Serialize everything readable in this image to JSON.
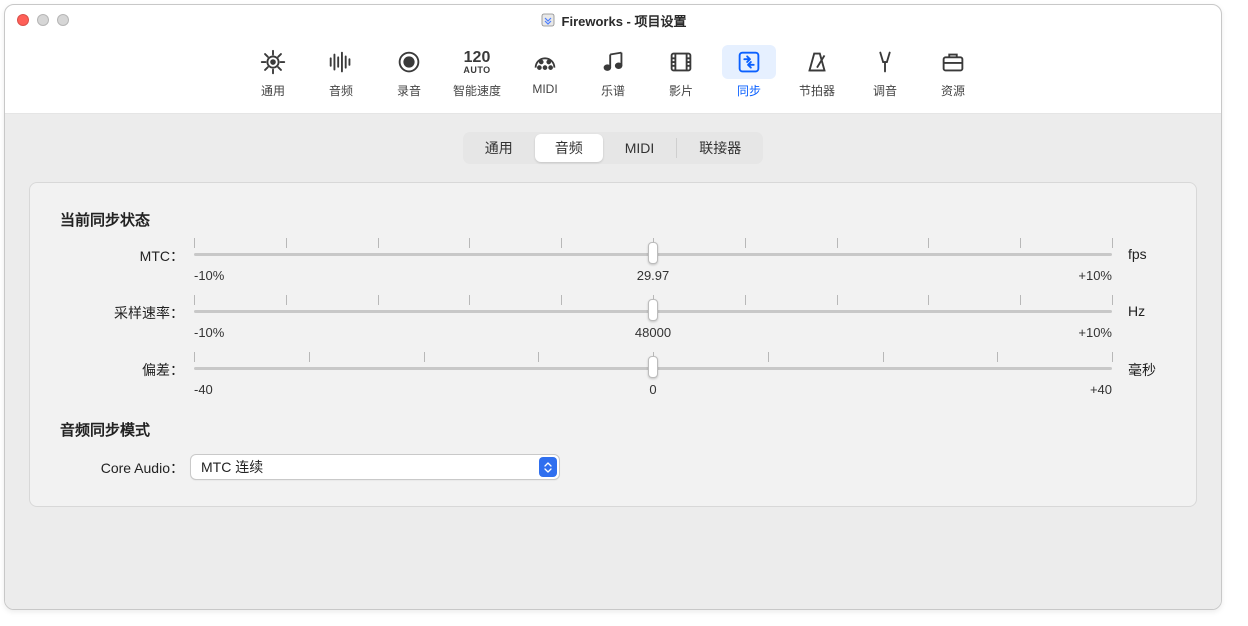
{
  "window": {
    "title": "Fireworks - 项目设置"
  },
  "toolbar": {
    "items": [
      {
        "label": "通用"
      },
      {
        "label": "音频"
      },
      {
        "label": "录音"
      },
      {
        "label": "智能速度",
        "top": "120",
        "sub": "AUTO"
      },
      {
        "label": "MIDI"
      },
      {
        "label": "乐谱"
      },
      {
        "label": "影片"
      },
      {
        "label": "同步"
      },
      {
        "label": "节拍器"
      },
      {
        "label": "调音"
      },
      {
        "label": "资源"
      }
    ]
  },
  "segmented": {
    "items": [
      "通用",
      "音频",
      "MIDI",
      "联接器"
    ],
    "selected": 1
  },
  "sections": {
    "sync_status_title": "当前同步状态",
    "audio_sync_mode_title": "音频同步模式"
  },
  "sliders": {
    "mtc": {
      "label": "MTC：",
      "left": "-10%",
      "mid": "29.97",
      "right": "+10%",
      "unit": "fps",
      "pos": 50
    },
    "sample_rate": {
      "label": "采样速率：",
      "left": "-10%",
      "mid": "48000",
      "right": "+10%",
      "unit": "Hz",
      "pos": 50
    },
    "offset": {
      "label": "偏差：",
      "left": "-40",
      "mid": "0",
      "right": "+40",
      "unit": "毫秒",
      "pos": 50
    }
  },
  "core_audio": {
    "label": "Core Audio：",
    "value": "MTC 连续"
  }
}
